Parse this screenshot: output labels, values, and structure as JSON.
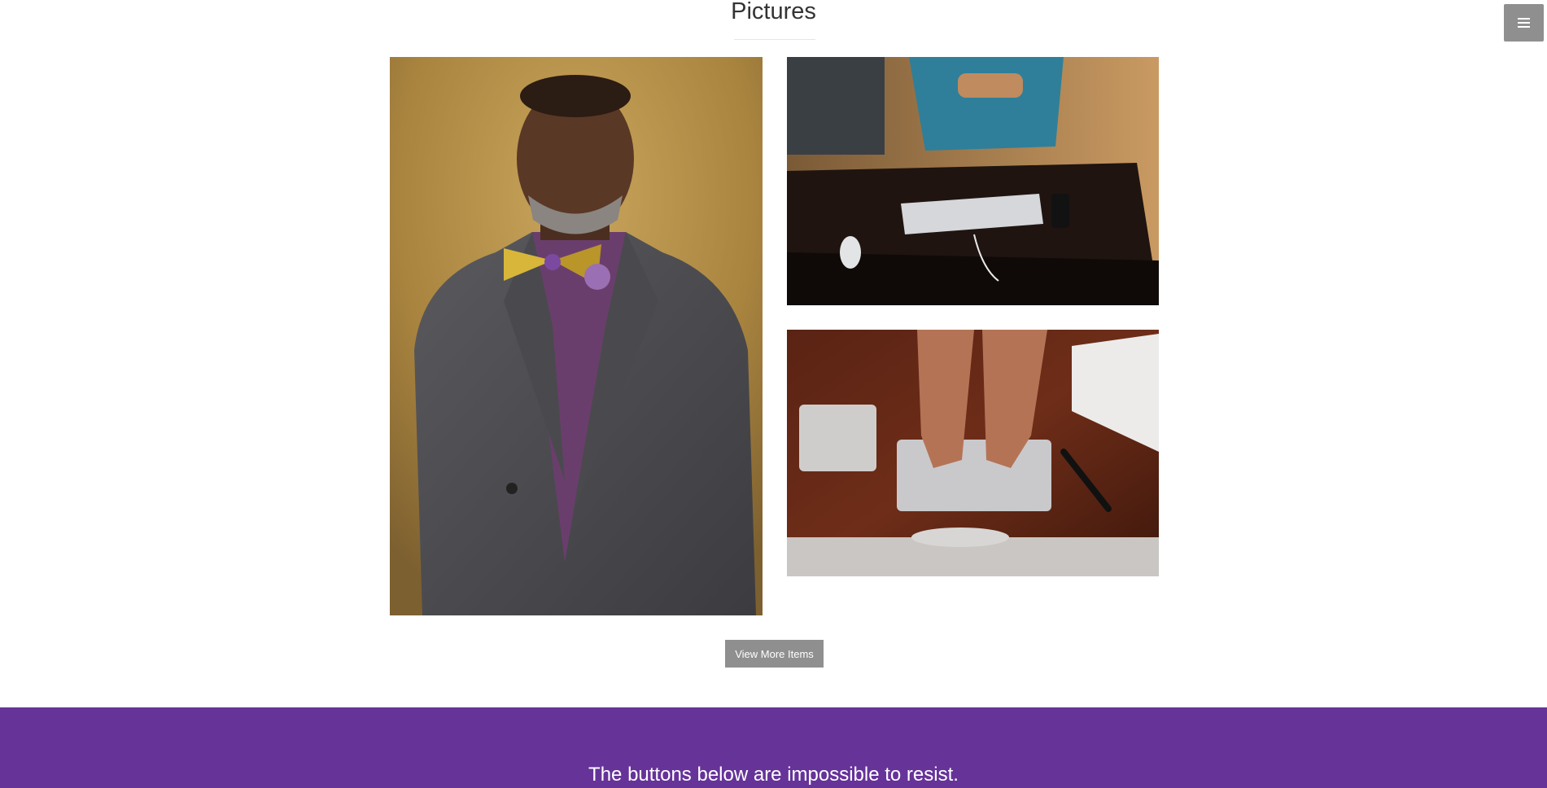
{
  "header": {
    "title": "Pictures"
  },
  "menu_toggle": {
    "icon": "hamburger-menu-icon",
    "color": "#8f8f8f"
  },
  "gallery": {
    "items": [
      {
        "subject": "portrait-photo"
      },
      {
        "subject": "desk-keyboard-photo"
      },
      {
        "subject": "typing-hands-photo"
      }
    ]
  },
  "actions": {
    "view_more_label": "View More Items"
  },
  "cta": {
    "text": "The buttons below are impossible to resist.",
    "background_color": "#663399"
  }
}
